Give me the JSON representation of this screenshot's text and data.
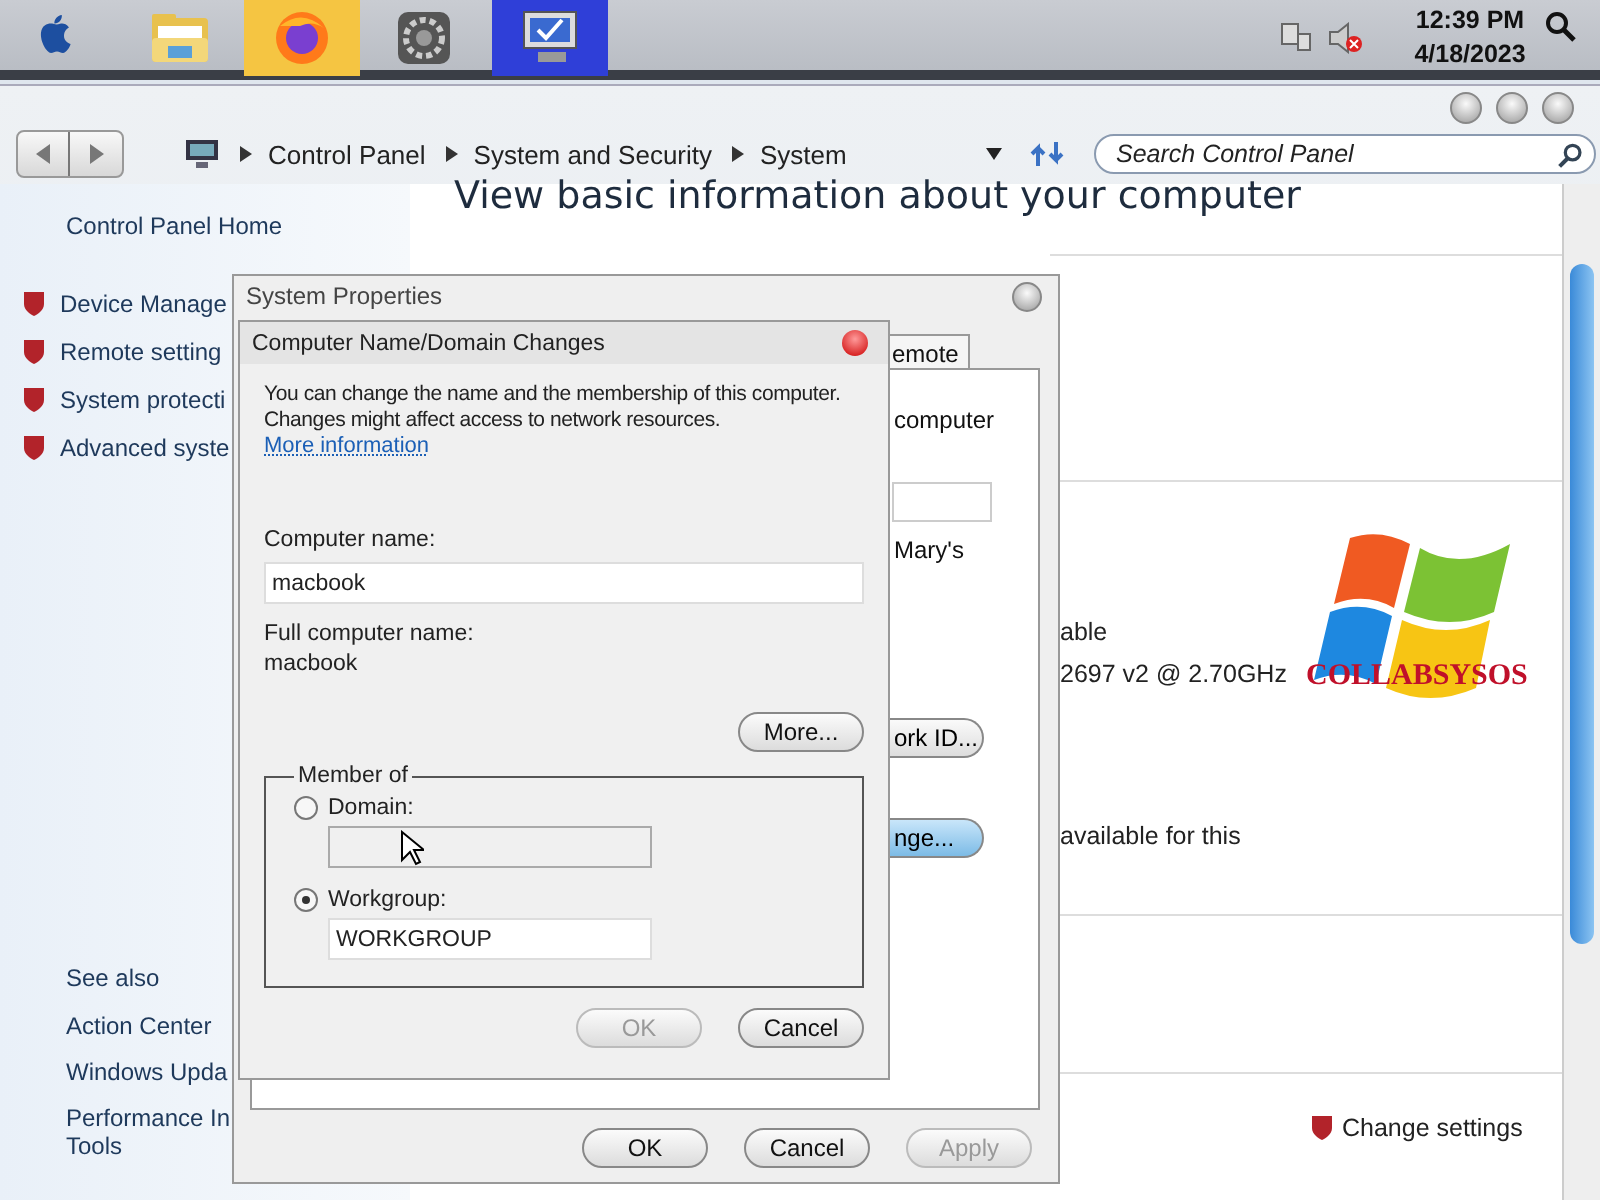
{
  "menu_bar": {
    "apps": [
      {
        "kind": "folder",
        "selected": false
      },
      {
        "kind": "browser",
        "selected": true
      },
      {
        "kind": "gear",
        "selected": false
      },
      {
        "kind": "monitor",
        "selected": true
      }
    ],
    "time": "12:39 PM",
    "date": "4/18/2023"
  },
  "explorer": {
    "breadcrumb": [
      "Control Panel",
      "System and Security",
      "System"
    ],
    "search": {
      "placeholder": "Search Control Panel"
    },
    "sidebar": {
      "home": "Control Panel Home",
      "tasks": [
        "Device Manage",
        "Remote setting",
        "System protecti",
        "Advanced syste"
      ],
      "see_also_title": "See also",
      "see_also": [
        "Action Center",
        "Windows Upda",
        "Performance In Tools"
      ]
    },
    "heading": "View basic information about your computer",
    "fragments": [
      "able",
      "2697 v2 @ 2.70GHz",
      "available for this"
    ],
    "logo_text": "COLLABSYSOS",
    "change_settings": "Change settings"
  },
  "system_properties": {
    "title": "System Properties",
    "tab": "emote",
    "text_1": "computer",
    "text_2": "Mary's",
    "network_button": "ork ID...",
    "change_button": "nge...",
    "buttons": [
      {
        "label": "OK",
        "disabled": false
      },
      {
        "label": "Cancel",
        "disabled": false
      },
      {
        "label": "Apply",
        "disabled": true
      }
    ]
  },
  "name_dialog": {
    "title": "Computer Name/Domain Changes",
    "description": "You can change the name and the membership of this computer. Changes might affect access to network resources.",
    "link": "More information",
    "computer_name_label": "Computer name:",
    "computer_name": "macbook",
    "full_name_label": "Full computer name:",
    "full_name": "macbook",
    "more_button": "More...",
    "member_of": "Member of",
    "options": [
      {
        "label": "Domain:",
        "selected": false
      },
      {
        "label": "Workgroup:",
        "selected": true,
        "value": "WORKGROUP"
      }
    ],
    "buttons": [
      {
        "label": "OK",
        "disabled": true
      },
      {
        "label": "Cancel",
        "disabled": false
      }
    ]
  }
}
